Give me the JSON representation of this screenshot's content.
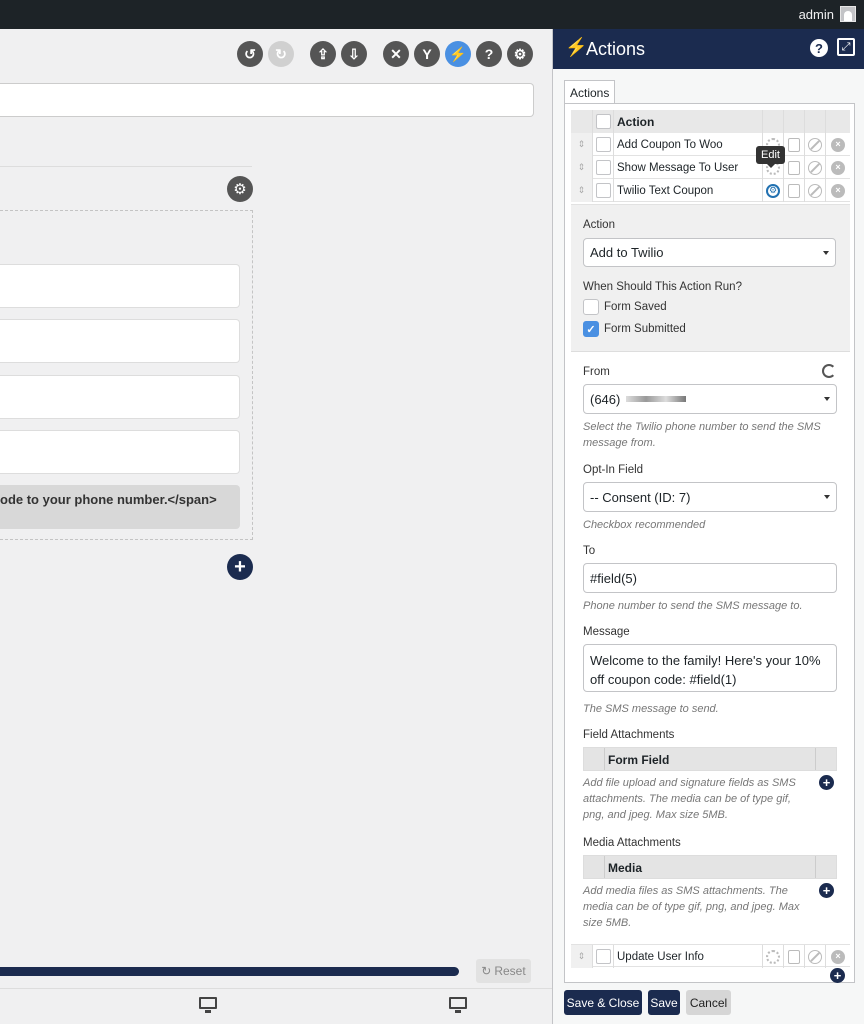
{
  "adminbar": {
    "user": "admin"
  },
  "builder": {
    "span_text": "ode to your phone number.</span>",
    "reset_label": "Reset",
    "progress": 1.0
  },
  "panel": {
    "title": "Actions",
    "tab": "Actions",
    "table": {
      "header": "Action",
      "rows": [
        {
          "name": "Add Coupon To Woo"
        },
        {
          "name": "Show Message To User"
        },
        {
          "name": "Twilio Text Coupon"
        }
      ],
      "tooltip": "Edit",
      "last_row": "Update User Info"
    },
    "settings": {
      "action_label": "Action",
      "action_value": "Add to Twilio",
      "when_label": "When Should This Action Run?",
      "opt_saved": "Form Saved",
      "opt_submitted": "Form Submitted"
    },
    "from": {
      "label": "From",
      "value": "(646)",
      "hint": "Select the Twilio phone number to send the SMS message from."
    },
    "optin": {
      "label": "Opt-In Field",
      "value": "-- Consent (ID: 7)",
      "hint": "Checkbox recommended"
    },
    "to": {
      "label": "To",
      "value": "#field(5)",
      "hint": "Phone number to send the SMS message to."
    },
    "message": {
      "label": "Message",
      "line1": "Welcome to the family! Here's your 10%",
      "line2": "off coupon code: #field(1)",
      "hint": "The SMS message to send."
    },
    "field_attach": {
      "label": "Field Attachments",
      "col": "Form Field",
      "hint1": "Add file upload and signature fields as SMS",
      "hint2": "attachments. The media can be of type gif,",
      "hint3": "png, and jpeg. Max size 5MB."
    },
    "media_attach": {
      "label": "Media Attachments",
      "col": "Media",
      "hint1": "Add media files as SMS attachments. The",
      "hint2": "media can be of type gif, png, and jpeg. Max",
      "hint3": "size 5MB."
    },
    "buttons": {
      "save_close": "Save & Close",
      "save": "Save",
      "cancel": "Cancel"
    }
  }
}
